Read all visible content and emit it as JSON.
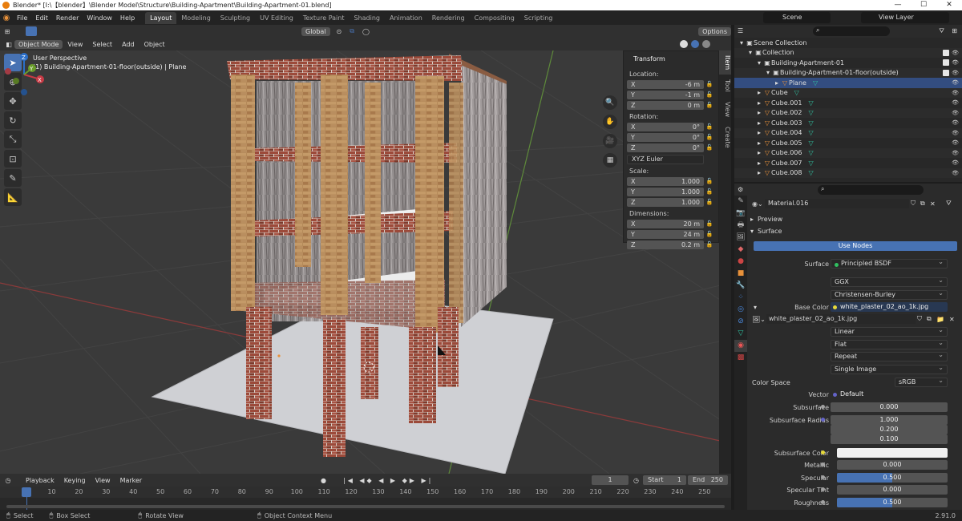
{
  "window": {
    "title": "Blender* [I:\\【blender】\\Blender Model\\Structure\\Building-Apartment\\Building-Apartment-01.blend]",
    "minimize": "—",
    "maximize": "☐",
    "close": "✕"
  },
  "menu": [
    "File",
    "Edit",
    "Render",
    "Window",
    "Help"
  ],
  "workspaces": [
    "Layout",
    "Modeling",
    "Sculpting",
    "UV Editing",
    "Texture Paint",
    "Shading",
    "Animation",
    "Rendering",
    "Compositing",
    "Scripting"
  ],
  "active_workspace": "Layout",
  "scene": "Scene",
  "view_layer": "View Layer",
  "viewport": {
    "mode": "Object Mode",
    "menus": [
      "View",
      "Select",
      "Add",
      "Object"
    ],
    "orientation": "Global",
    "options": "Options",
    "info_line1": "User Perspective",
    "info_line2": "(1) Building-Apartment-01-floor(outside) | Plane"
  },
  "gizmo": {
    "x": "X",
    "y": "Y",
    "z": "Z"
  },
  "npanel": {
    "title": "Transform",
    "location_label": "Location:",
    "location": [
      {
        "axis": "X",
        "value": "-6 m"
      },
      {
        "axis": "Y",
        "value": "-1 m"
      },
      {
        "axis": "Z",
        "value": "0 m"
      }
    ],
    "rotation_label": "Rotation:",
    "rotation": [
      {
        "axis": "X",
        "value": "0°"
      },
      {
        "axis": "Y",
        "value": "0°"
      },
      {
        "axis": "Z",
        "value": "0°"
      }
    ],
    "rotation_mode": "XYZ Euler",
    "scale_label": "Scale:",
    "scale": [
      {
        "axis": "X",
        "value": "1.000"
      },
      {
        "axis": "Y",
        "value": "1.000"
      },
      {
        "axis": "Z",
        "value": "1.000"
      }
    ],
    "dimensions_label": "Dimensions:",
    "dimensions": [
      {
        "axis": "X",
        "value": "20 m"
      },
      {
        "axis": "Y",
        "value": "24 m"
      },
      {
        "axis": "Z",
        "value": "0.2 m"
      }
    ],
    "tabs": [
      "Item",
      "Tool",
      "View",
      "Create"
    ]
  },
  "outliner": [
    {
      "label": "Scene Collection",
      "indent": 0
    },
    {
      "label": "Collection",
      "indent": 1
    },
    {
      "label": "Building-Apartment-01",
      "indent": 2
    },
    {
      "label": "Building-Apartment-01-floor(outside)",
      "indent": 3
    },
    {
      "label": "Plane",
      "indent": 4
    },
    {
      "label": "Cube",
      "indent": 2
    },
    {
      "label": "Cube.001",
      "indent": 2
    },
    {
      "label": "Cube.002",
      "indent": 2
    },
    {
      "label": "Cube.003",
      "indent": 2
    },
    {
      "label": "Cube.004",
      "indent": 2
    },
    {
      "label": "Cube.005",
      "indent": 2
    },
    {
      "label": "Cube.006",
      "indent": 2
    },
    {
      "label": "Cube.007",
      "indent": 2
    },
    {
      "label": "Cube.008",
      "indent": 2
    }
  ],
  "properties": {
    "material": "Material.016",
    "preview": "Preview",
    "surface_header": "Surface",
    "use_nodes": "Use Nodes",
    "surface_label": "Surface",
    "surface_value": "Principled BSDF",
    "dist": "GGX",
    "sss_method": "Christensen-Burley",
    "base_color_label": "Base Color",
    "base_color_value": "white_plaster_02_ao_1k.jpg",
    "image_name": "white_plaster_02_ao_1k.jpg",
    "interp": "Linear",
    "proj": "Flat",
    "ext": "Repeat",
    "source": "Single Image",
    "color_space_label": "Color Space",
    "color_space": "sRGB",
    "vector_label": "Vector",
    "vector_value": "Default",
    "subsurface_label": "Subsurface",
    "subsurface": "0.000",
    "ss_radius_label": "Subsurface Radius",
    "ss_radius": [
      "1.000",
      "0.200",
      "0.100"
    ],
    "ss_color_label": "Subsurface Color",
    "metallic_label": "Metallic",
    "metallic": "0.000",
    "specular_label": "Specular",
    "specular": "0.500",
    "specular_fill": 0.5,
    "spec_tint_label": "Specular Tint",
    "spec_tint": "0.000",
    "roughness_label": "Roughness",
    "roughness": "0.500",
    "roughness_fill": 0.5
  },
  "timeline": {
    "menus": [
      "Playback",
      "Keying",
      "View",
      "Marker"
    ],
    "current": "1",
    "start_label": "Start",
    "start": "1",
    "end_label": "End",
    "end": "250",
    "ticks": [
      "1",
      "10",
      "20",
      "30",
      "40",
      "50",
      "60",
      "70",
      "80",
      "90",
      "100",
      "110",
      "120",
      "130",
      "140",
      "150",
      "160",
      "170",
      "180",
      "190",
      "200",
      "210",
      "220",
      "230",
      "240",
      "250"
    ]
  },
  "status": {
    "select": "Select",
    "box_select": "Box Select",
    "rotate": "Rotate View",
    "context": "Object Context Menu",
    "version": "2.91.0"
  },
  "colors": {
    "accent": "#4772b3",
    "orange": "#e8913a",
    "teal": "#30c0a0"
  }
}
